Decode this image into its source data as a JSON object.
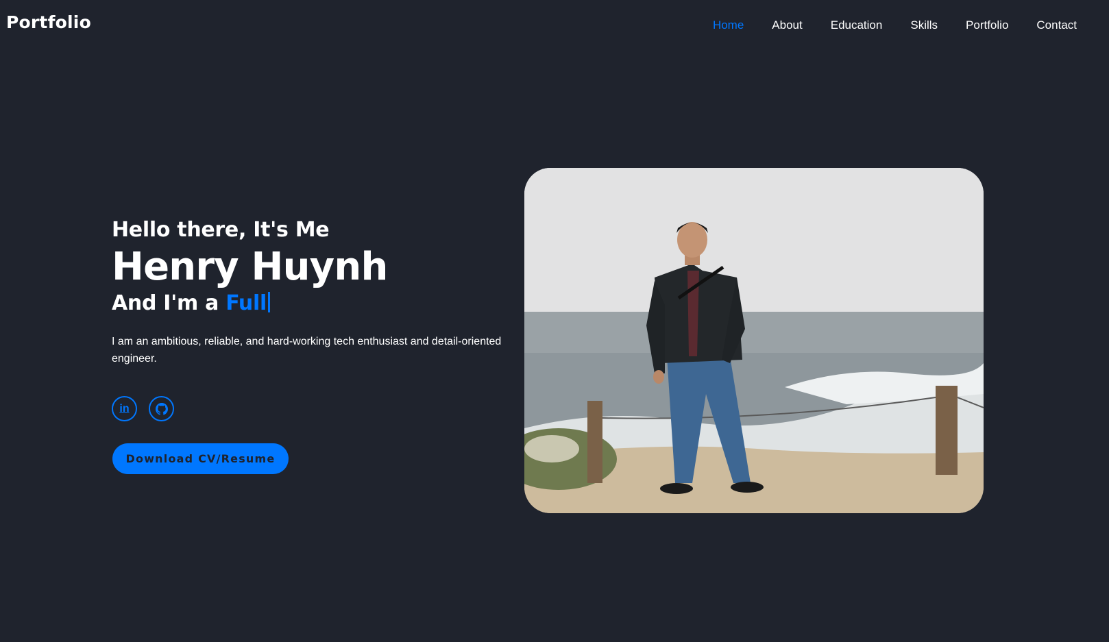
{
  "header": {
    "logo": "Portfolio",
    "nav": [
      {
        "label": "Home",
        "active": true
      },
      {
        "label": "About",
        "active": false
      },
      {
        "label": "Education",
        "active": false
      },
      {
        "label": "Skills",
        "active": false
      },
      {
        "label": "Portfolio",
        "active": false
      },
      {
        "label": "Contact",
        "active": false
      }
    ]
  },
  "hero": {
    "greeting": "Hello there, It's Me",
    "name": "Henry Huynh",
    "role_prefix": "And I'm a ",
    "role_typed": "Full",
    "bio": "I am an ambitious, reliable, and hard-working tech enthusiast and detail-oriented engineer.",
    "socials": [
      {
        "icon": "linkedin-icon",
        "glyph": "in"
      },
      {
        "icon": "github-icon"
      }
    ],
    "cv_button": "Download CV/Resume"
  },
  "colors": {
    "background": "#1f232d",
    "accent": "#0077ff",
    "text": "#ffffff"
  }
}
